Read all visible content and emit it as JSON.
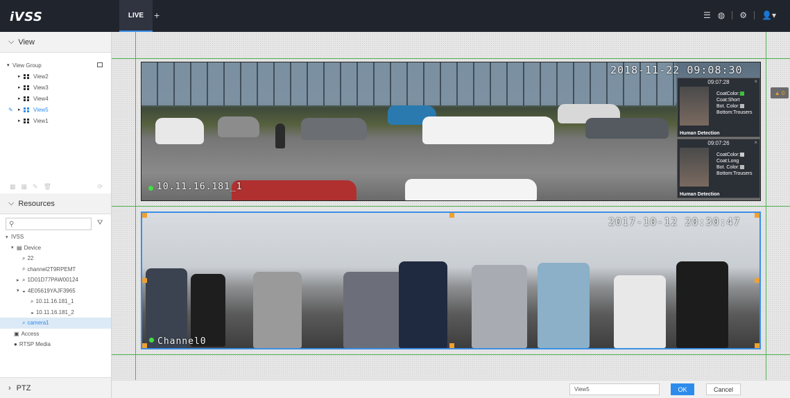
{
  "app": {
    "logo": "iVSS"
  },
  "header": {
    "tabs": [
      {
        "label": "LIVE"
      }
    ],
    "add_tab": "+",
    "icons": [
      "list-icon",
      "globe-icon",
      "settings-icon",
      "user-icon"
    ]
  },
  "sidebar": {
    "view_section": {
      "label": "View"
    },
    "view_tree": {
      "root": "View Group",
      "items": [
        {
          "label": "View2"
        },
        {
          "label": "View3"
        },
        {
          "label": "View4"
        },
        {
          "label": "View5",
          "selected": true
        },
        {
          "label": "View1"
        }
      ]
    },
    "resources_section": {
      "label": "Resources"
    },
    "search_placeholder": "",
    "resource_tree": {
      "root": "IVSS",
      "device_group": "Device",
      "items": [
        {
          "label": "22"
        },
        {
          "label": "channel2T9RPEMT"
        },
        {
          "label": "1D01D77PAW00124"
        },
        {
          "label": "4E05619YAJF3965"
        },
        {
          "label": "10.11.16.181_1"
        },
        {
          "label": "10.11.16.181_2"
        },
        {
          "label": "camera1",
          "selected": true
        }
      ],
      "access": "Access",
      "rtsp": "RTSP Media"
    },
    "ptz_section": {
      "label": "PTZ"
    }
  },
  "panes": [
    {
      "timestamp": "2018-11-22 09:08:30",
      "channel_label": "10.11.16.181_1",
      "detections": [
        {
          "time": "09:07:28",
          "attrs": [
            "CoatColor:",
            "Coat:Short",
            "Bot. Color:",
            "Bottom:Trousers"
          ],
          "coat_color": "#3fbf3f",
          "bottom_color": "#bbbbbb",
          "caption": "Human Detection"
        },
        {
          "time": "09:07:26",
          "attrs": [
            "CoatColor:",
            "Coat:Long",
            "Bot. Color:",
            "Bottom:Trousers"
          ],
          "coat_color": "#cccccc",
          "bottom_color": "#bbbbbb",
          "caption": "Human Detection"
        }
      ]
    },
    {
      "timestamp": "2017-10-12 20:30:47",
      "channel_label": "Channel0"
    }
  ],
  "alarm_badge": {
    "count": "0"
  },
  "bottombar": {
    "view_name_value": "View5",
    "ok": "OK",
    "cancel": "Cancel"
  }
}
